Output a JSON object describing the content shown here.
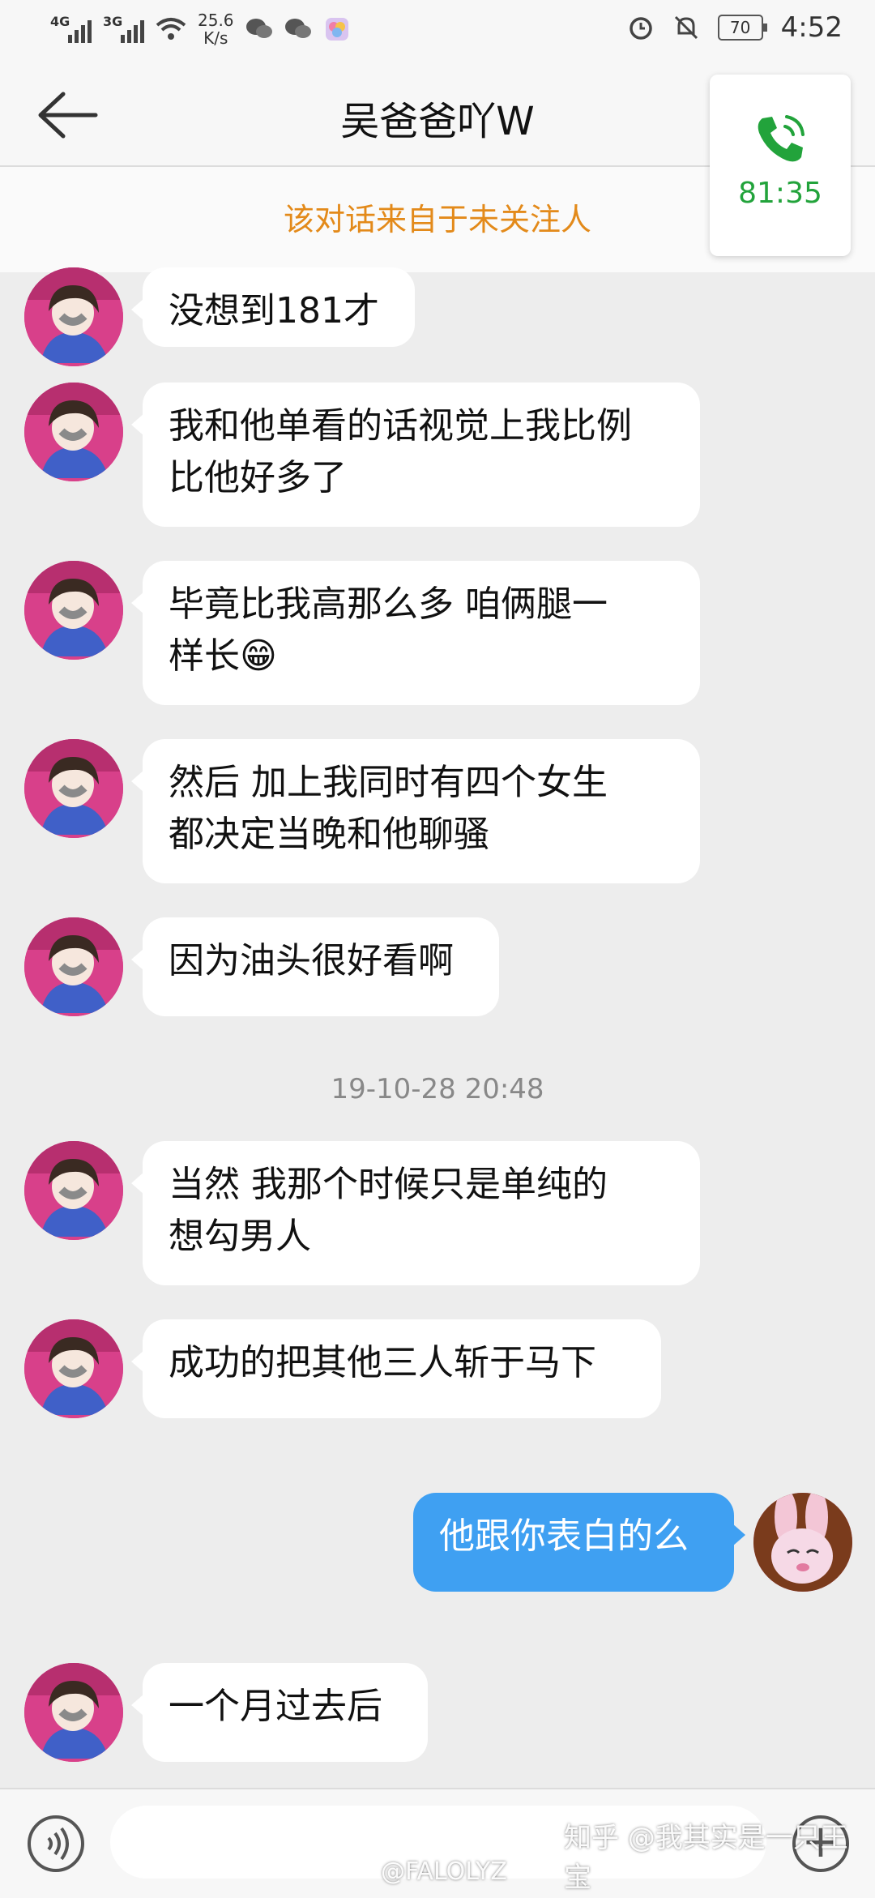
{
  "status_bar": {
    "net1": "4G",
    "net2": "3G",
    "speed": "25.6",
    "speed_unit": "K/s",
    "battery": "70",
    "time": "4:52",
    "icons": [
      "wechat-icon",
      "wechat-icon",
      "app-icon",
      "alarm-icon",
      "mute-icon"
    ]
  },
  "header": {
    "title": "吴爸爸吖W",
    "notice": "该对话来自于未关注人"
  },
  "call_card": {
    "duration": "81:35",
    "icon": "phone-call-icon"
  },
  "messages": [
    {
      "side": "left",
      "text": "没想到181才"
    },
    {
      "side": "left",
      "text": "我和他单看的话视觉上我比例\n比他好多了"
    },
    {
      "side": "left",
      "text": "毕竟比我高那么多 咱俩腿一\n样长😁"
    },
    {
      "side": "left",
      "text": "然后 加上我同时有四个女生\n都决定当晚和他聊骚"
    },
    {
      "side": "left",
      "text": "因为油头很好看啊"
    },
    {
      "side": "left",
      "text": "当然 我那个时候只是单纯的\n想勾男人"
    },
    {
      "side": "left",
      "text": "成功的把其他三人斩于马下"
    },
    {
      "side": "right",
      "text": "他跟你表白的么"
    },
    {
      "side": "left",
      "text": "一个月过去后"
    }
  ],
  "timestamp": "19-10-28 20:48",
  "watermarks": {
    "zhihu": "知乎 @我其实是一只王宝",
    "weibo": "@FALOLYZ"
  },
  "colors": {
    "accent_blue": "#3fa0f2",
    "notice_orange": "#e38a1a",
    "call_green": "#22a33b"
  }
}
